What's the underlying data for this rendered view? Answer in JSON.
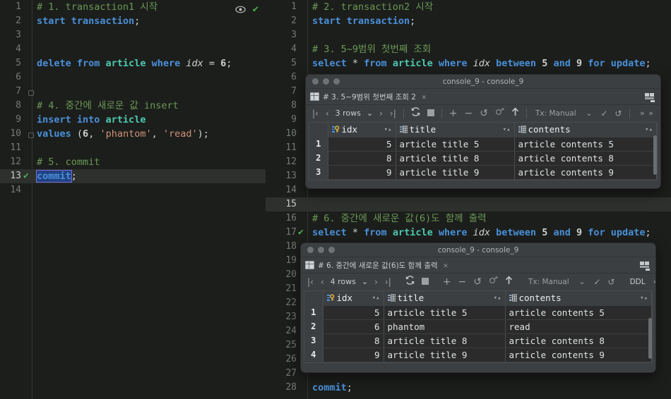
{
  "left_editor": {
    "name": "transaction1-editor",
    "gutter_marks": {
      "line13_status": "✔"
    },
    "header_icons": {
      "eye": "eye-icon",
      "check": "✔"
    },
    "lines": [
      {
        "n": "1",
        "tokens": [
          {
            "t": "# 1. transaction1 시작",
            "c": "cm"
          }
        ]
      },
      {
        "n": "2",
        "tokens": [
          {
            "t": "start transaction",
            "c": "kw"
          },
          {
            "t": ";",
            "c": "pun"
          }
        ]
      },
      {
        "n": "3",
        "tokens": []
      },
      {
        "n": "4",
        "tokens": []
      },
      {
        "n": "5",
        "tokens": [
          {
            "t": "delete from ",
            "c": "kw"
          },
          {
            "t": "article",
            "c": "tbl"
          },
          {
            "t": " where ",
            "c": "kw"
          },
          {
            "t": "idx",
            "c": "col"
          },
          {
            "t": " = ",
            "c": "pun"
          },
          {
            "t": "6",
            "c": "num2"
          },
          {
            "t": ";",
            "c": "pun"
          }
        ]
      },
      {
        "n": "6",
        "tokens": []
      },
      {
        "n": "7",
        "tokens": []
      },
      {
        "n": "8",
        "tokens": [
          {
            "t": "# 4. 중간에 새로운 값 insert",
            "c": "cm"
          }
        ]
      },
      {
        "n": "9",
        "tokens": [
          {
            "t": "insert into ",
            "c": "kw"
          },
          {
            "t": "article",
            "c": "tbl"
          }
        ]
      },
      {
        "n": "10",
        "tokens": [
          {
            "t": "values",
            "c": "kw"
          },
          {
            "t": " (",
            "c": "pun"
          },
          {
            "t": "6",
            "c": "num2"
          },
          {
            "t": ", ",
            "c": "pun"
          },
          {
            "t": "'phantom'",
            "c": "str"
          },
          {
            "t": ", ",
            "c": "pun"
          },
          {
            "t": "'read'",
            "c": "str"
          },
          {
            "t": ");",
            "c": "pun"
          }
        ]
      },
      {
        "n": "11",
        "tokens": []
      },
      {
        "n": "12",
        "tokens": [
          {
            "t": "# 5. commit",
            "c": "cm"
          }
        ]
      },
      {
        "n": "13",
        "tokens": [
          {
            "t": "commit",
            "c": "sel"
          },
          {
            "t": ";",
            "c": "pun"
          }
        ],
        "current": true,
        "ok": "✔"
      },
      {
        "n": "14",
        "tokens": []
      }
    ]
  },
  "right_editor": {
    "name": "transaction2-editor",
    "lines": [
      {
        "n": "1",
        "tokens": [
          {
            "t": "# 2. transaction2 시작",
            "c": "cm"
          }
        ]
      },
      {
        "n": "2",
        "tokens": [
          {
            "t": "start transaction",
            "c": "kw"
          },
          {
            "t": ";",
            "c": "pun"
          }
        ]
      },
      {
        "n": "3",
        "tokens": []
      },
      {
        "n": "4",
        "tokens": [
          {
            "t": "# 3. 5~9범위 첫번째 조회",
            "c": "cm"
          }
        ]
      },
      {
        "n": "5",
        "tokens": [
          {
            "t": "select ",
            "c": "kw"
          },
          {
            "t": "*",
            "c": "pun"
          },
          {
            "t": " from ",
            "c": "kw"
          },
          {
            "t": "article",
            "c": "tbl"
          },
          {
            "t": " where ",
            "c": "kw"
          },
          {
            "t": "idx",
            "c": "col"
          },
          {
            "t": " between ",
            "c": "kw"
          },
          {
            "t": "5",
            "c": "num2"
          },
          {
            "t": " and ",
            "c": "kw"
          },
          {
            "t": "9",
            "c": "num2"
          },
          {
            "t": " for update",
            "c": "kw"
          },
          {
            "t": ";",
            "c": "pun"
          }
        ]
      },
      {
        "n": "6",
        "tokens": []
      },
      {
        "n": "7",
        "tokens": []
      },
      {
        "n": "8",
        "tokens": []
      },
      {
        "n": "9",
        "tokens": []
      },
      {
        "n": "10",
        "tokens": []
      },
      {
        "n": "11",
        "tokens": []
      },
      {
        "n": "12",
        "tokens": []
      },
      {
        "n": "13",
        "tokens": []
      },
      {
        "n": "14",
        "tokens": []
      },
      {
        "n": "15",
        "tokens": [],
        "current": true
      },
      {
        "n": "16",
        "tokens": [
          {
            "t": "# 6. 중간에 새로운 값(6)도 함께 출력",
            "c": "cm"
          }
        ]
      },
      {
        "n": "17",
        "tokens": [
          {
            "t": "select ",
            "c": "kw"
          },
          {
            "t": "*",
            "c": "pun"
          },
          {
            "t": " from ",
            "c": "kw"
          },
          {
            "t": "article",
            "c": "tbl"
          },
          {
            "t": " where ",
            "c": "kw"
          },
          {
            "t": "idx",
            "c": "col"
          },
          {
            "t": " between ",
            "c": "kw"
          },
          {
            "t": "5",
            "c": "num2"
          },
          {
            "t": " and ",
            "c": "kw"
          },
          {
            "t": "9",
            "c": "num2"
          },
          {
            "t": " for update",
            "c": "kw"
          },
          {
            "t": ";",
            "c": "pun"
          }
        ],
        "ok": "✔"
      },
      {
        "n": "18",
        "tokens": []
      },
      {
        "n": "19",
        "tokens": []
      },
      {
        "n": "20",
        "tokens": []
      },
      {
        "n": "21",
        "tokens": []
      },
      {
        "n": "22",
        "tokens": []
      },
      {
        "n": "23",
        "tokens": []
      },
      {
        "n": "24",
        "tokens": []
      },
      {
        "n": "25",
        "tokens": []
      },
      {
        "n": "26",
        "tokens": []
      },
      {
        "n": "27",
        "tokens": []
      },
      {
        "n": "28",
        "tokens": [
          {
            "t": "commit",
            "c": "kw"
          },
          {
            "t": ";",
            "c": "pun"
          }
        ]
      }
    ]
  },
  "result_window_1": {
    "title": "console_9 - console_9",
    "tab_label": "# 3. 5~9범위 첫번째 조회 2",
    "tab_close": "✕",
    "toolbar": {
      "first": "|‹",
      "prev": "‹",
      "rows": "3 rows",
      "rows_caret": "⌄",
      "next": "›",
      "last": "›|",
      "refresh": "refresh-icon",
      "stop": "stop-icon",
      "add": "+",
      "remove": "−",
      "revert": "↺",
      "revert_selected": "revert-selected-icon",
      "submit": "↑",
      "tx_mode": "Tx: Manual",
      "tx_caret": "⌄",
      "commit": "✓",
      "rollback": "↺",
      "overflow": "» »"
    },
    "columns": [
      "idx",
      "title",
      "contents"
    ],
    "rows": [
      {
        "n": "1",
        "idx": "5",
        "title": "article title 5",
        "contents": "article contents 5"
      },
      {
        "n": "2",
        "idx": "8",
        "title": "article title 8",
        "contents": "article contents 8"
      },
      {
        "n": "3",
        "idx": "9",
        "title": "article title 9",
        "contents": "article contents 9"
      }
    ]
  },
  "result_window_2": {
    "title": "console_9 - console_9",
    "tab_label": "# 6. 중간에 새로운 값(6)도 함께 출력",
    "tab_close": "✕",
    "toolbar": {
      "first": "|‹",
      "prev": "‹",
      "rows": "4 rows",
      "rows_caret": "⌄",
      "next": "›",
      "last": "›|",
      "refresh": "refresh-icon",
      "stop": "stop-icon",
      "add": "+",
      "remove": "−",
      "revert": "↺",
      "revert_selected": "revert-selected-icon",
      "submit": "↑",
      "tx_mode": "Tx: Manual",
      "tx_caret": "⌄",
      "commit": "✓",
      "rollback": "↺",
      "ddl": "DDL",
      "overflow": "» »"
    },
    "columns": [
      "idx",
      "title",
      "contents"
    ],
    "rows": [
      {
        "n": "1",
        "idx": "5",
        "title": "article title 5",
        "contents": "article contents 5"
      },
      {
        "n": "2",
        "idx": "6",
        "title": "phantom",
        "contents": "read"
      },
      {
        "n": "3",
        "idx": "8",
        "title": "article title 8",
        "contents": "article contents 8"
      },
      {
        "n": "4",
        "idx": "9",
        "title": "article title 9",
        "contents": "article contents 9"
      }
    ]
  },
  "colors": {
    "editor_bg": "#1c1e1c",
    "panel_bg": "#3c3f41",
    "grid_bg": "#2b2b2b",
    "keyword": "#4a90d9",
    "comment": "#6a9955",
    "table": "#4ec9b0",
    "string": "#ce9178",
    "success": "#4caf50"
  }
}
